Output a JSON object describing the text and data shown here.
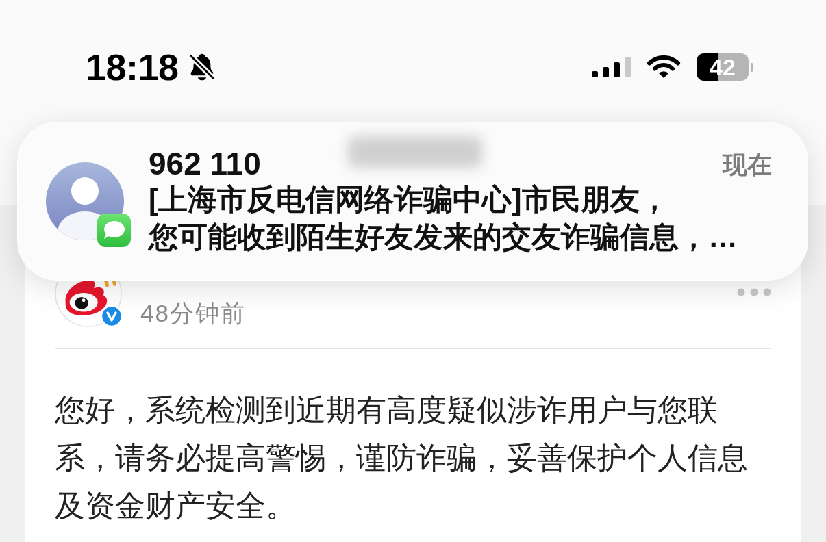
{
  "status_bar": {
    "time": "18:18",
    "battery": "42"
  },
  "notification": {
    "sender": "962 110",
    "time": "现在",
    "message_lines": [
      "[上海市反电信网络诈骗中心]市民朋友，",
      "您可能收到陌生好友发来的交友诈骗信息，…"
    ]
  },
  "post": {
    "verified": true,
    "time": "48分钟前",
    "body": "您好，系统检测到近期有高度疑似涉诈用户与您联系，请务必提高警惕，谨防诈骗，妥善保护个人信息及资金财产安全。"
  }
}
